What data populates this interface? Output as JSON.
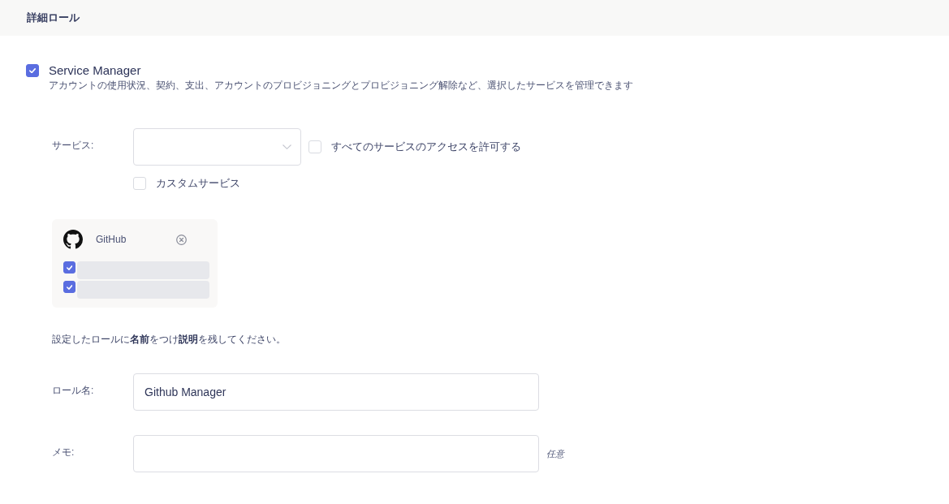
{
  "header": {
    "title": "詳細ロール"
  },
  "role": {
    "title": "Service Manager",
    "description": "アカウントの使用状況、契約、支出、アカウントのプロビジョニングとプロビジョニング解除など、選択したサービスを管理できます",
    "checked": true
  },
  "service_field": {
    "label": "サービス:",
    "allow_all": {
      "label": "すべてのサービスのアクセスを許可する",
      "checked": false
    },
    "custom": {
      "label": "カスタムサービス",
      "checked": false
    }
  },
  "selected_services": [
    {
      "name": "GitHub",
      "items": [
        {
          "checked": true
        },
        {
          "checked": true
        }
      ]
    }
  ],
  "instruction": "設定したロールに**名前**をつけ**説明**を残してください。",
  "fields": [
    {
      "label": "ロール名:",
      "value": "Github Manager"
    },
    {
      "label": "メモ:",
      "note": "任意"
    }
  ]
}
